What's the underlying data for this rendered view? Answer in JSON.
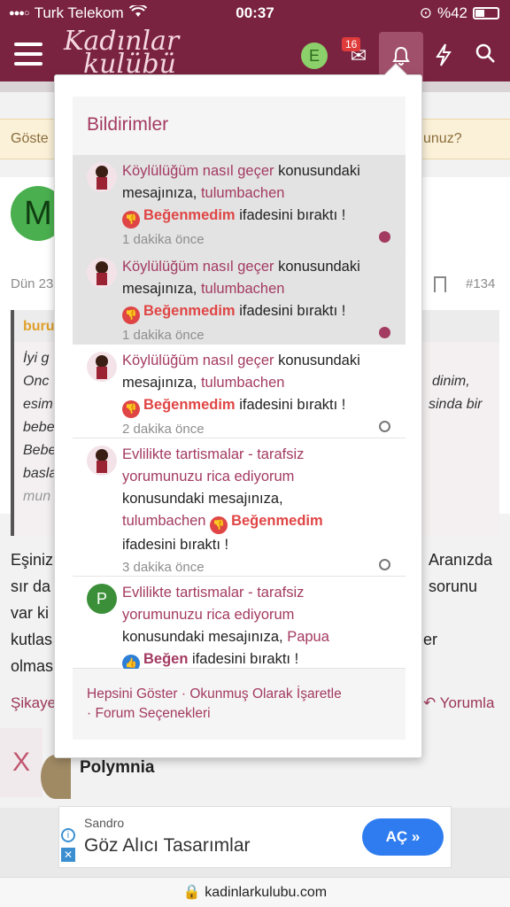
{
  "status_bar": {
    "carrier": "Turk Telekom",
    "time": "00:37",
    "battery": "%42"
  },
  "header": {
    "logo_line1": "Kadınlar",
    "logo_line2": "kulübü",
    "user_initial": "E",
    "mail_badge": "16"
  },
  "background": {
    "notice_left": "Göste",
    "notice_right": "unuz?",
    "post_avatar_initial": "M",
    "post_date": "Dün 23",
    "post_number": "#134",
    "quote_author": "buru",
    "quote_lines": [
      "İyi g",
      "Onc",
      "esim",
      "bebe",
      "Bebe",
      "basla",
      "mun"
    ],
    "quote_right_lines": [
      "dinim,",
      "sinda bir"
    ],
    "body_left": [
      "Eşiniz",
      "sır da",
      "var ki",
      "kutlas",
      "olmas"
    ],
    "body_right": [
      "Aranızda",
      "sorunu",
      "er"
    ],
    "report_label": "Şikaye",
    "reply_label": "Yorumla",
    "next_user": "Polymnia",
    "close_label": "X"
  },
  "notifications": {
    "title": "Bildirimler",
    "items": [
      {
        "thread": "Köylülüğüm nasıl geçer",
        "suffix1": "konusundaki",
        "suffix2": "mesajınıza,",
        "user": "tulumbachen",
        "reaction": "Beğenmedim",
        "reaction_type": "negative",
        "action": "ifadesini bıraktı !",
        "time": "1 dakika önce",
        "unread": true
      },
      {
        "thread": "Köylülüğüm nasıl geçer",
        "suffix1": "konusundaki",
        "suffix2": "mesajınıza,",
        "user": "tulumbachen",
        "reaction": "Beğenmedim",
        "reaction_type": "negative",
        "action": "ifadesini bıraktı !",
        "time": "1 dakika önce",
        "unread": true
      },
      {
        "thread": "Köylülüğüm nasıl geçer",
        "suffix1": "konusundaki",
        "suffix2": "mesajınıza,",
        "user": "tulumbachen",
        "reaction": "Beğenmedim",
        "reaction_type": "negative",
        "action": "ifadesini bıraktı !",
        "time": "2 dakika önce",
        "unread": false
      },
      {
        "thread_line1": "Evlilikte tartismalar - tarafsiz",
        "thread_line2": "yorumunuzu rica ediyorum",
        "suffix": "konusundaki mesajınıza,",
        "user": "tulumbachen",
        "reaction": "Beğenmedim",
        "reaction_type": "negative",
        "action": "ifadesini bıraktı !",
        "time": "3 dakika önce",
        "unread": false
      },
      {
        "avatar_initial": "P",
        "thread_line1": "Evlilikte tartismalar - tarafsiz",
        "thread_line2": "yorumunuzu rica ediyorum",
        "suffix": "konusundaki mesajınıza,",
        "user": "Papua",
        "reaction": "Beğen",
        "reaction_type": "positive",
        "action": "ifadesini bıraktı !"
      }
    ],
    "footer": {
      "show_all": "Hepsini Göster",
      "mark_read": "Okunmuş Olarak İşaretle",
      "options": "Forum Seçenekleri"
    }
  },
  "ad": {
    "brand": "Sandro",
    "headline": "Göz Alıcı Tasarımlar",
    "button": "AÇ"
  },
  "url": "kadinlarkulubu.com",
  "colors": {
    "brand": "#7a2340",
    "link": "#a33a60",
    "negative": "#e04545",
    "positive": "#2d7fd6"
  }
}
